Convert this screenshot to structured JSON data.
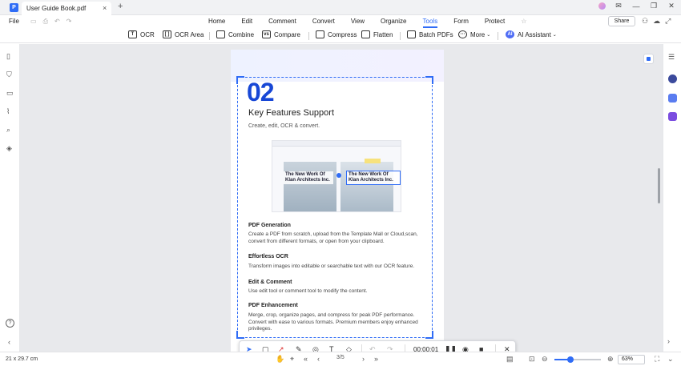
{
  "app": {
    "logo_glyph": "P"
  },
  "titlebar": {
    "tab_title": "User Guide Book.pdf",
    "close_glyph": "×",
    "new_tab_glyph": "+",
    "minimize_glyph": "—",
    "restore_glyph": "❐",
    "window_close_glyph": "✕"
  },
  "menubar": {
    "file": "File",
    "tabs": [
      "Home",
      "Edit",
      "Comment",
      "Convert",
      "View",
      "Organize",
      "Tools",
      "Form",
      "Protect"
    ],
    "active_tab": "Tools",
    "share": "Share"
  },
  "toolbar": {
    "ocr": "OCR",
    "ocr_area": "OCR Area",
    "combine": "Combine",
    "compare": "Compare",
    "compress": "Compress",
    "flatten": "Flatten",
    "batch_pdfs": "Batch PDFs",
    "more": "More",
    "ai_assistant": "AI Assistant"
  },
  "document": {
    "number": "02",
    "heading": "Key Features Support",
    "subheading": "Create, edit, OCR & convert.",
    "thumb_left_label": "The New Work Of Klan Architects Inc.",
    "thumb_right_label": "The New Work Of Klan Architects Inc.",
    "sections": [
      {
        "title": "PDF Generation",
        "body": "Create a PDF from scratch, upload from the Template Mall or Cloud,scan, convert from different formats, or open from your clipboard."
      },
      {
        "title": "Effortless OCR",
        "body": "Transform images into editable or searchable text with our OCR feature."
      },
      {
        "title": "Edit & Comment",
        "body": "Use edit tool or comment tool to modify the content."
      },
      {
        "title": "PDF Enhancement",
        "body": "Merge, crop, organize pages, and compress for peak PDF performance. Convert with ease to various formats. Premium members enjoy enhanced privileges."
      }
    ]
  },
  "recorder": {
    "timer": "00:00:01"
  },
  "statusbar": {
    "page_size": "21 x 29.7 cm",
    "page_indicator": "3/5",
    "zoom": "63%",
    "zoom_level": 0.35
  },
  "colors": {
    "accent": "#2f6cf6",
    "number_blue": "#1747d6"
  },
  "icons": {
    "left_rail": [
      "page-thumbnail-icon",
      "bookmark-icon",
      "comment-icon",
      "attachment-icon",
      "search-icon",
      "layers-icon"
    ],
    "right_rail": [
      "settings-sliders-icon",
      "ai-robot-icon",
      "translate-icon",
      "proofread-icon"
    ]
  }
}
